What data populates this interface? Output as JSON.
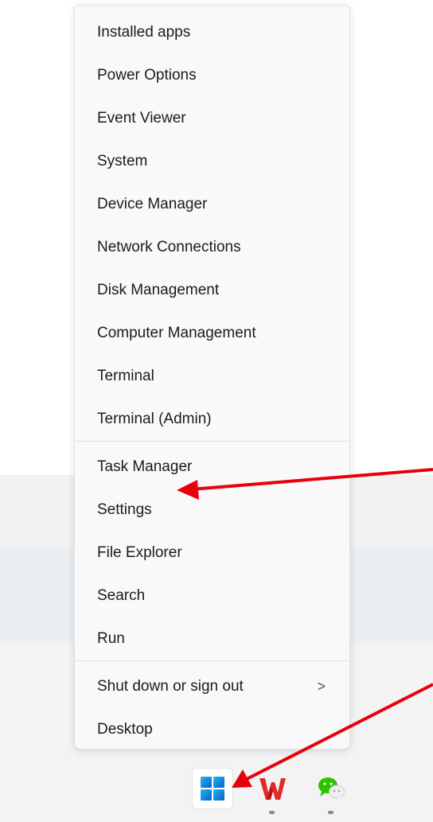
{
  "context_menu": {
    "items": [
      {
        "label": "Installed apps"
      },
      {
        "label": "Power Options"
      },
      {
        "label": "Event Viewer"
      },
      {
        "label": "System"
      },
      {
        "label": "Device Manager"
      },
      {
        "label": "Network Connections"
      },
      {
        "label": "Disk Management"
      },
      {
        "label": "Computer Management"
      },
      {
        "label": "Terminal"
      },
      {
        "label": "Terminal (Admin)"
      },
      {
        "label": "Task Manager"
      },
      {
        "label": "Settings"
      },
      {
        "label": "File Explorer"
      },
      {
        "label": "Search"
      },
      {
        "label": "Run"
      },
      {
        "label": "Shut down or sign out",
        "submenu_indicator": ">"
      },
      {
        "label": "Desktop"
      }
    ]
  },
  "taskbar": {
    "apps": [
      {
        "name": "start-button",
        "icon": "windows-logo-icon"
      },
      {
        "name": "wps-office",
        "icon": "wps-logo-icon"
      },
      {
        "name": "wechat",
        "icon": "wechat-icon"
      }
    ]
  },
  "annotations": {
    "arrow_color": "#e8000b"
  },
  "colors": {
    "windows_blue": "#0078d4",
    "wps_red": "#e02a2a",
    "wechat_green": "#2dc100"
  }
}
